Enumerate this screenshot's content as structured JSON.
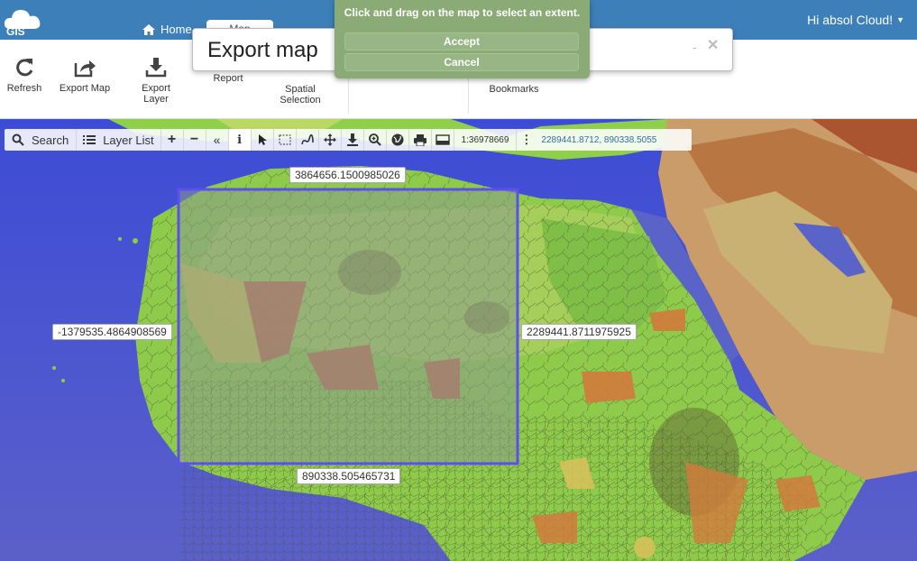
{
  "app": {
    "logo_text": "GIS",
    "user_menu": "Hi absol Cloud!"
  },
  "nav": {
    "home": "Home",
    "map_tab": "Map"
  },
  "ribbon": {
    "refresh": "Refresh",
    "export_map": "Export Map",
    "export_layer_1": "Export",
    "export_layer_2": "Layer",
    "report": "Report",
    "spatial_1": "Spatial",
    "spatial_2": "Selection",
    "bookmarks": "Bookmarks"
  },
  "dialog": {
    "title": "Export map",
    "minimize": "-",
    "close": "✕"
  },
  "prompt": {
    "text": "Click and drag on the map to select an extent.",
    "accept": "Accept",
    "cancel": "Cancel"
  },
  "maptools": {
    "search": "Search",
    "layer_list": "Layer List",
    "scale": "1:36978669",
    "coords": "2289441.8712, 890338.5055"
  },
  "extent": {
    "top": "3864656.1500985026",
    "left": "-1379535.4864908569",
    "right": "2289441.8711975925",
    "bottom": "890338.505465731"
  },
  "colors": {
    "topbar": "#3d7fb8",
    "prompt": "#8aaa76",
    "selection": "#5b4ff0"
  }
}
